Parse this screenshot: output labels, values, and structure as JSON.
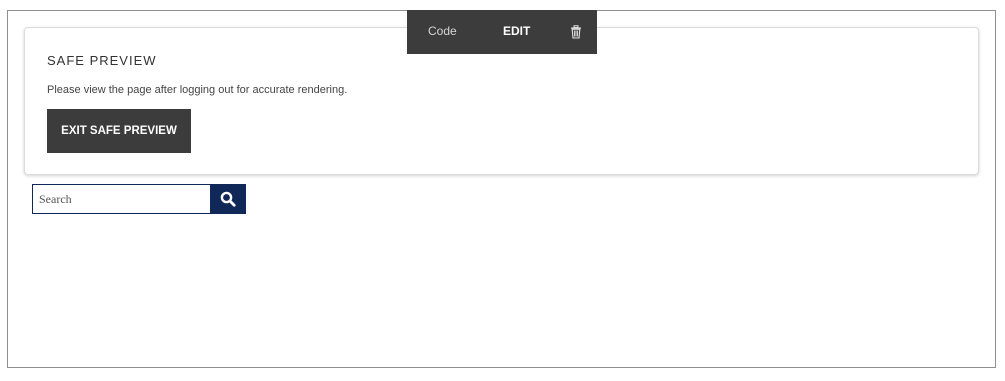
{
  "toolbar": {
    "code_label": "Code",
    "edit_label": "EDIT",
    "delete_icon": "trash-icon"
  },
  "safe_preview": {
    "title": "SAFE PREVIEW",
    "description": "Please view the page after logging out for accurate rendering.",
    "exit_button_label": "EXIT SAFE PREVIEW"
  },
  "search": {
    "placeholder": "Search",
    "value": "",
    "button_icon": "search-icon"
  },
  "colors": {
    "toolbar_bg": "#3c3c3c",
    "search_accent": "#0f2857",
    "frame_border": "#8f8f8f"
  }
}
